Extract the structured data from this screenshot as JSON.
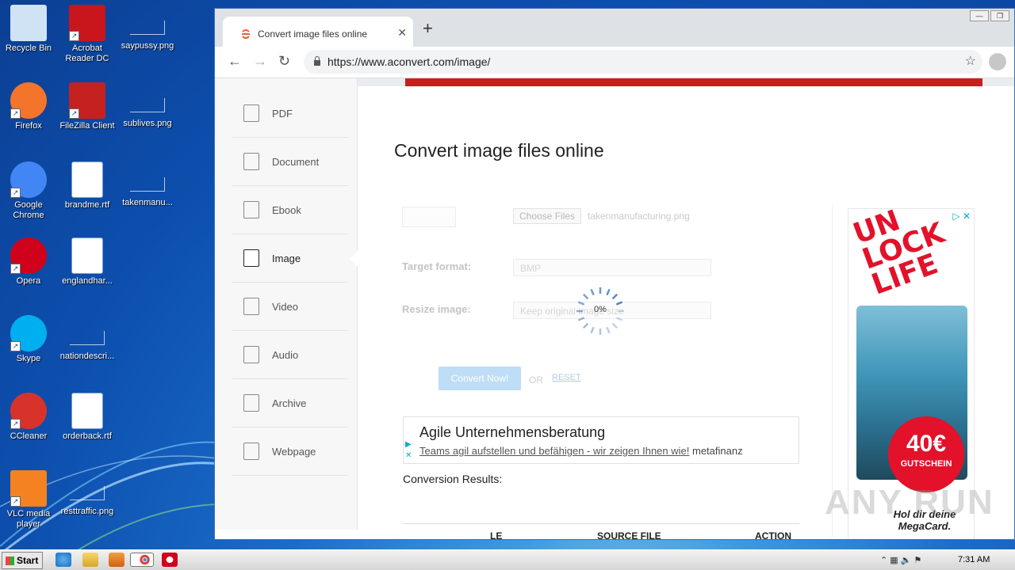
{
  "desktop": {
    "icons": [
      {
        "label": "Recycle Bin",
        "icon": "recycle-bin-icon"
      },
      {
        "label": "Acrobat Reader DC",
        "icon": "acrobat-icon"
      },
      {
        "label": "saypussy.png",
        "icon": "png-file-icon"
      },
      {
        "label": "Firefox",
        "icon": "firefox-icon"
      },
      {
        "label": "FileZilla Client",
        "icon": "filezilla-icon"
      },
      {
        "label": "sublives.png",
        "icon": "png-file-icon"
      },
      {
        "label": "Google Chrome",
        "icon": "chrome-icon"
      },
      {
        "label": "brandme.rtf",
        "icon": "word-doc-icon"
      },
      {
        "label": "takenmanu...",
        "icon": "png-file-icon"
      },
      {
        "label": "Opera",
        "icon": "opera-icon"
      },
      {
        "label": "englandhar...",
        "icon": "word-doc-icon"
      },
      {
        "label": "Skype",
        "icon": "skype-icon"
      },
      {
        "label": "nationdescri...",
        "icon": "png-file-icon"
      },
      {
        "label": "CCleaner",
        "icon": "ccleaner-icon"
      },
      {
        "label": "orderback.rtf",
        "icon": "word-doc-icon"
      },
      {
        "label": "VLC media player",
        "icon": "vlc-icon"
      },
      {
        "label": "resttraffic.png",
        "icon": "png-file-icon"
      }
    ]
  },
  "browser": {
    "tab_title": "Convert image files online",
    "url": "https://www.aconvert.com/image/"
  },
  "sidebar": {
    "items": [
      {
        "label": "PDF",
        "icon": "pdf-icon"
      },
      {
        "label": "Document",
        "icon": "document-icon"
      },
      {
        "label": "Ebook",
        "icon": "ebook-icon"
      },
      {
        "label": "Image",
        "icon": "image-icon"
      },
      {
        "label": "Video",
        "icon": "video-icon"
      },
      {
        "label": "Audio",
        "icon": "audio-icon"
      },
      {
        "label": "Archive",
        "icon": "archive-icon"
      },
      {
        "label": "Webpage",
        "icon": "webpage-icon"
      }
    ],
    "active": "Image"
  },
  "main": {
    "title": "Convert image files online",
    "choose_files": "Choose Files",
    "file_name": "takenmanufacturing.png",
    "target_format_label": "Target format:",
    "target_format_value": "BMP",
    "resize_label": "Resize image:",
    "resize_value": "Keep original image size",
    "progress_text": "0%",
    "progress": 0,
    "convert_button": "Convert Now!",
    "or_text": "OR",
    "reset_link": "RESET",
    "ad": {
      "title": "Agile Unternehmensberatung",
      "link_text": "Teams agil aufstellen und befähigen - wir zeigen Ihnen wie!",
      "advertiser": "metafinanz"
    },
    "results_label": "Conversion Results:",
    "table_headers": [
      "LE",
      "SOURCE FILE",
      "ACTION"
    ]
  },
  "side_ad": {
    "headline": "UN LOCK LIFE",
    "badge_value": "40€",
    "badge_label": "GUTSCHEIN",
    "tagline": "Hol dir deine MegaCard."
  },
  "watermark": "ANY RUN",
  "taskbar": {
    "start_label": "Start",
    "clock": "7:31 AM"
  }
}
